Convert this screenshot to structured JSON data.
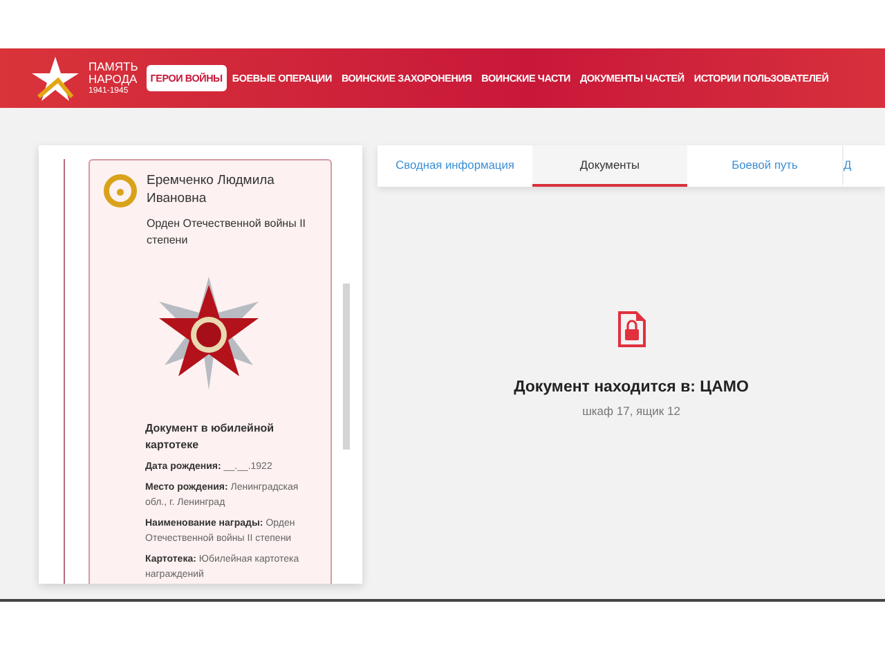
{
  "header": {
    "logo": {
      "line_1": "ПАМЯТЬ",
      "line_2": "НАРОДА",
      "years": "1941-1945"
    },
    "nav": [
      {
        "label": "ГЕРОИ ВОЙНЫ",
        "selected": true
      },
      {
        "label": "БОЕВЫЕ ОПЕРАЦИИ",
        "selected": false
      },
      {
        "label": "ВОИНСКИЕ ЗАХОРОНЕНИЯ",
        "selected": false
      },
      {
        "label": "ВОИНСКИЕ ЧАСТИ",
        "selected": false
      },
      {
        "label": "ДОКУМЕНТЫ ЧАСТЕЙ",
        "selected": false
      },
      {
        "label": "ИСТОРИИ ПОЛЬЗОВАТЕЛЕЙ",
        "selected": false
      }
    ]
  },
  "award_card": {
    "name": "Еремченко Людмила Ивановна",
    "award": "Орден Отечественной войны II степени",
    "document_title": "Документ в юбилейной картотеке",
    "fields": [
      {
        "text": "**Дата рождения:** __.__.1922"
      },
      {
        "text": "**Место рождения:** Ленинградская обл., г. Ленинград"
      },
      {
        "text": "**Наименование награды:** Орден Отечественной войны II степени"
      },
      {
        "text": "**Картотека:** Юбилейная картотека награждений"
      }
    ]
  },
  "tabs": [
    {
      "label": "Сводная информация",
      "selected": false
    },
    {
      "label": "Документы",
      "selected": true
    },
    {
      "label": "Боевой путь",
      "selected": false
    },
    {
      "label": "Д",
      "selected": false
    }
  ],
  "document": {
    "location": "Документ находится в: ЦАМО",
    "storage": "шкаф 17, ящик 12"
  }
}
